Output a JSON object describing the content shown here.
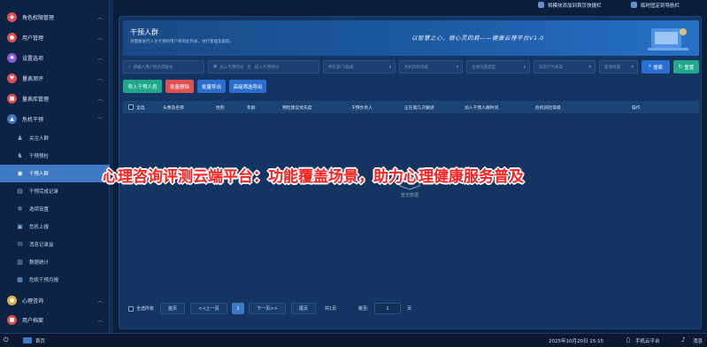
{
  "sidebar": {
    "items": [
      {
        "label": "角色权限管理",
        "icon": "role-icon",
        "color": "#e0504f"
      },
      {
        "label": "用户管理",
        "icon": "user-icon",
        "color": "#e0504f"
      },
      {
        "label": "设置选项",
        "icon": "settings-icon",
        "color": "#8a5bd6"
      },
      {
        "label": "量表测评",
        "icon": "heart-icon",
        "color": "#e0504f"
      },
      {
        "label": "量表库管理",
        "icon": "library-icon",
        "color": "#e0504f"
      },
      {
        "label": "危机干预",
        "icon": "crisis-icon",
        "color": "#3f78c4"
      }
    ],
    "sub_items": [
      {
        "label": "关注人群",
        "icon": "people-icon"
      },
      {
        "label": "干预预检",
        "icon": "precheck-icon"
      },
      {
        "label": "干预人群",
        "icon": "intervene-icon"
      },
      {
        "label": "干预完成记录",
        "icon": "record-icon"
      },
      {
        "label": "选项设置",
        "icon": "gear-icon"
      },
      {
        "label": "危机上报",
        "icon": "report-icon"
      },
      {
        "label": "消息记录盒",
        "icon": "message-icon"
      },
      {
        "label": "数据统计",
        "icon": "chart-icon"
      },
      {
        "label": "危机干预月报",
        "icon": "monthly-icon"
      }
    ],
    "bottom_items": [
      {
        "label": "心理咨询",
        "icon": "counsel-icon",
        "color": "#e0b040"
      },
      {
        "label": "用户档案",
        "icon": "profile-icon",
        "color": "#e0504f"
      }
    ]
  },
  "topbar": {
    "add_shortcut": "将模块添加到首页快捷栏",
    "pin_nav": "临时固定到导航栏"
  },
  "banner": {
    "title": "干预人群",
    "desc": "对需要进行人为干预的用户将到此列表，进行管理及跟踪。",
    "slogan": "以智慧之心，做心灵的肩——健康云理平台V1.0"
  },
  "filters": {
    "search_placeholder": "请输入用户姓名或账号",
    "date_start": "加入干预时间",
    "date_sep": "至",
    "date_end": "加入干预时间",
    "dept": "所在部门/班级",
    "risk": "危机风险等级",
    "issue": "主要问题类型",
    "behavior": "异常行为表现",
    "period": "复测周期",
    "search_btn": "搜索",
    "reset_btn": "重置"
  },
  "actions": {
    "import": "导入干预人员",
    "batch_delete": "批量删除",
    "batch_export": "批量导出",
    "advanced_export": "高级筛选导出"
  },
  "table": {
    "select_all": "全选",
    "columns": [
      "头像及名称",
      "性别",
      "年龄",
      "预检建议优先度",
      "干预负责人",
      "正在第几次跟进",
      "加入干预人群时间",
      "危机风险等级",
      "操作"
    ],
    "empty": "暂无数据"
  },
  "pager": {
    "select_all": "全选所有",
    "first": "首页",
    "prev": "<<上一页",
    "current": "1",
    "next": "下一页>>",
    "last": "尾页",
    "total": "共1页",
    "jump_label": "跳至:",
    "jump_value": "1",
    "page_unit": "页"
  },
  "overlay": {
    "caption": "心理咨询评测云端平台：功能覆盖场景，助力心理健康服务普及"
  },
  "taskbar": {
    "home": "首页",
    "datetime": "2025年10月20日 15:15",
    "mobile": "手机云平台",
    "msg": "消息"
  }
}
